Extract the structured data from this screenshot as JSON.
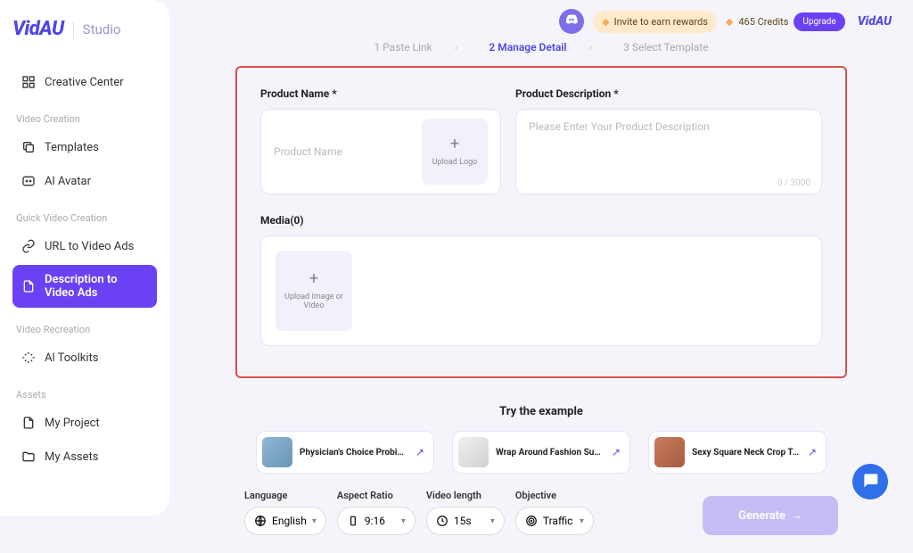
{
  "brand": {
    "logo": "VidAU",
    "studio": "Studio"
  },
  "sidebar": {
    "items": [
      {
        "label": "Creative Center"
      }
    ],
    "section_video_creation": "Video Creation",
    "video_creation_items": [
      {
        "label": "Templates"
      },
      {
        "label": "Al Avatar"
      }
    ],
    "section_quick": "Quick Video Creation",
    "quick_items": [
      {
        "label": "URL to Video Ads"
      },
      {
        "label": "Description to Video Ads"
      }
    ],
    "section_recreation": "Video Recreation",
    "recreation_items": [
      {
        "label": "Al Toolkits"
      }
    ],
    "section_assets": "Assets",
    "assets_items": [
      {
        "label": "My Project"
      },
      {
        "label": "My Assets"
      }
    ]
  },
  "topbar": {
    "invite": "Invite to earn rewards",
    "credits": "465 Credits",
    "upgrade": "Upgrade",
    "brand": "VidAU"
  },
  "stepper": {
    "s1": "1 Paste Link",
    "s2": "2 Manage Detail",
    "s3": "3 Select Template"
  },
  "form": {
    "name_label": "Product Name *",
    "name_placeholder": "Product Name",
    "upload_logo": "Upload Logo",
    "desc_label": "Product Description *",
    "desc_placeholder": "Please Enter Your Product Description",
    "counter": "0 / 3000",
    "media_label": "Media(0)",
    "upload_media": "Upload Image or Video"
  },
  "try": {
    "title": "Try the example",
    "items": [
      {
        "label": "Physician's Choice Probiot..."
      },
      {
        "label": "Wrap Around Fashion Sun..."
      },
      {
        "label": "Sexy Square Neck Crop To..."
      }
    ]
  },
  "controls": {
    "language_label": "Language",
    "language_value": "English",
    "aspect_label": "Aspect Ratio",
    "aspect_value": "9:16",
    "length_label": "Video length",
    "length_value": "15s",
    "objective_label": "Objective",
    "objective_value": "Traffic",
    "generate": "Generate"
  }
}
